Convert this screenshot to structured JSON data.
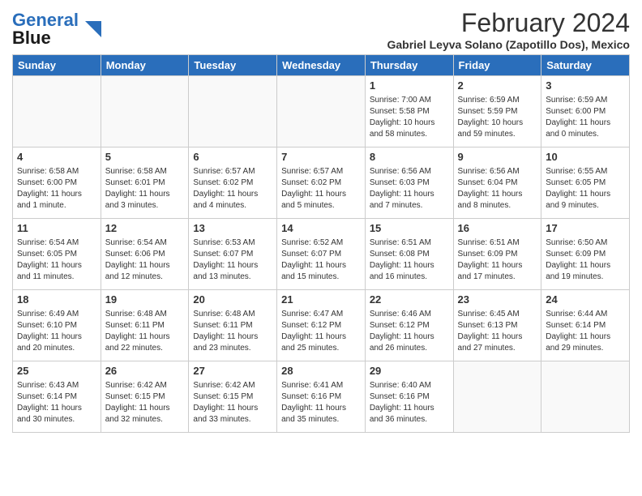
{
  "header": {
    "logo_general": "General",
    "logo_blue": "Blue",
    "title": "February 2024",
    "subtitle": "Gabriel Leyva Solano (Zapotillo Dos), Mexico"
  },
  "days_of_week": [
    "Sunday",
    "Monday",
    "Tuesday",
    "Wednesday",
    "Thursday",
    "Friday",
    "Saturday"
  ],
  "weeks": [
    [
      {
        "day": "",
        "info": ""
      },
      {
        "day": "",
        "info": ""
      },
      {
        "day": "",
        "info": ""
      },
      {
        "day": "",
        "info": ""
      },
      {
        "day": "1",
        "info": "Sunrise: 7:00 AM\nSunset: 5:58 PM\nDaylight: 10 hours\nand 58 minutes."
      },
      {
        "day": "2",
        "info": "Sunrise: 6:59 AM\nSunset: 5:59 PM\nDaylight: 10 hours\nand 59 minutes."
      },
      {
        "day": "3",
        "info": "Sunrise: 6:59 AM\nSunset: 6:00 PM\nDaylight: 11 hours\nand 0 minutes."
      }
    ],
    [
      {
        "day": "4",
        "info": "Sunrise: 6:58 AM\nSunset: 6:00 PM\nDaylight: 11 hours\nand 1 minute."
      },
      {
        "day": "5",
        "info": "Sunrise: 6:58 AM\nSunset: 6:01 PM\nDaylight: 11 hours\nand 3 minutes."
      },
      {
        "day": "6",
        "info": "Sunrise: 6:57 AM\nSunset: 6:02 PM\nDaylight: 11 hours\nand 4 minutes."
      },
      {
        "day": "7",
        "info": "Sunrise: 6:57 AM\nSunset: 6:02 PM\nDaylight: 11 hours\nand 5 minutes."
      },
      {
        "day": "8",
        "info": "Sunrise: 6:56 AM\nSunset: 6:03 PM\nDaylight: 11 hours\nand 7 minutes."
      },
      {
        "day": "9",
        "info": "Sunrise: 6:56 AM\nSunset: 6:04 PM\nDaylight: 11 hours\nand 8 minutes."
      },
      {
        "day": "10",
        "info": "Sunrise: 6:55 AM\nSunset: 6:05 PM\nDaylight: 11 hours\nand 9 minutes."
      }
    ],
    [
      {
        "day": "11",
        "info": "Sunrise: 6:54 AM\nSunset: 6:05 PM\nDaylight: 11 hours\nand 11 minutes."
      },
      {
        "day": "12",
        "info": "Sunrise: 6:54 AM\nSunset: 6:06 PM\nDaylight: 11 hours\nand 12 minutes."
      },
      {
        "day": "13",
        "info": "Sunrise: 6:53 AM\nSunset: 6:07 PM\nDaylight: 11 hours\nand 13 minutes."
      },
      {
        "day": "14",
        "info": "Sunrise: 6:52 AM\nSunset: 6:07 PM\nDaylight: 11 hours\nand 15 minutes."
      },
      {
        "day": "15",
        "info": "Sunrise: 6:51 AM\nSunset: 6:08 PM\nDaylight: 11 hours\nand 16 minutes."
      },
      {
        "day": "16",
        "info": "Sunrise: 6:51 AM\nSunset: 6:09 PM\nDaylight: 11 hours\nand 17 minutes."
      },
      {
        "day": "17",
        "info": "Sunrise: 6:50 AM\nSunset: 6:09 PM\nDaylight: 11 hours\nand 19 minutes."
      }
    ],
    [
      {
        "day": "18",
        "info": "Sunrise: 6:49 AM\nSunset: 6:10 PM\nDaylight: 11 hours\nand 20 minutes."
      },
      {
        "day": "19",
        "info": "Sunrise: 6:48 AM\nSunset: 6:11 PM\nDaylight: 11 hours\nand 22 minutes."
      },
      {
        "day": "20",
        "info": "Sunrise: 6:48 AM\nSunset: 6:11 PM\nDaylight: 11 hours\nand 23 minutes."
      },
      {
        "day": "21",
        "info": "Sunrise: 6:47 AM\nSunset: 6:12 PM\nDaylight: 11 hours\nand 25 minutes."
      },
      {
        "day": "22",
        "info": "Sunrise: 6:46 AM\nSunset: 6:12 PM\nDaylight: 11 hours\nand 26 minutes."
      },
      {
        "day": "23",
        "info": "Sunrise: 6:45 AM\nSunset: 6:13 PM\nDaylight: 11 hours\nand 27 minutes."
      },
      {
        "day": "24",
        "info": "Sunrise: 6:44 AM\nSunset: 6:14 PM\nDaylight: 11 hours\nand 29 minutes."
      }
    ],
    [
      {
        "day": "25",
        "info": "Sunrise: 6:43 AM\nSunset: 6:14 PM\nDaylight: 11 hours\nand 30 minutes."
      },
      {
        "day": "26",
        "info": "Sunrise: 6:42 AM\nSunset: 6:15 PM\nDaylight: 11 hours\nand 32 minutes."
      },
      {
        "day": "27",
        "info": "Sunrise: 6:42 AM\nSunset: 6:15 PM\nDaylight: 11 hours\nand 33 minutes."
      },
      {
        "day": "28",
        "info": "Sunrise: 6:41 AM\nSunset: 6:16 PM\nDaylight: 11 hours\nand 35 minutes."
      },
      {
        "day": "29",
        "info": "Sunrise: 6:40 AM\nSunset: 6:16 PM\nDaylight: 11 hours\nand 36 minutes."
      },
      {
        "day": "",
        "info": ""
      },
      {
        "day": "",
        "info": ""
      }
    ]
  ]
}
